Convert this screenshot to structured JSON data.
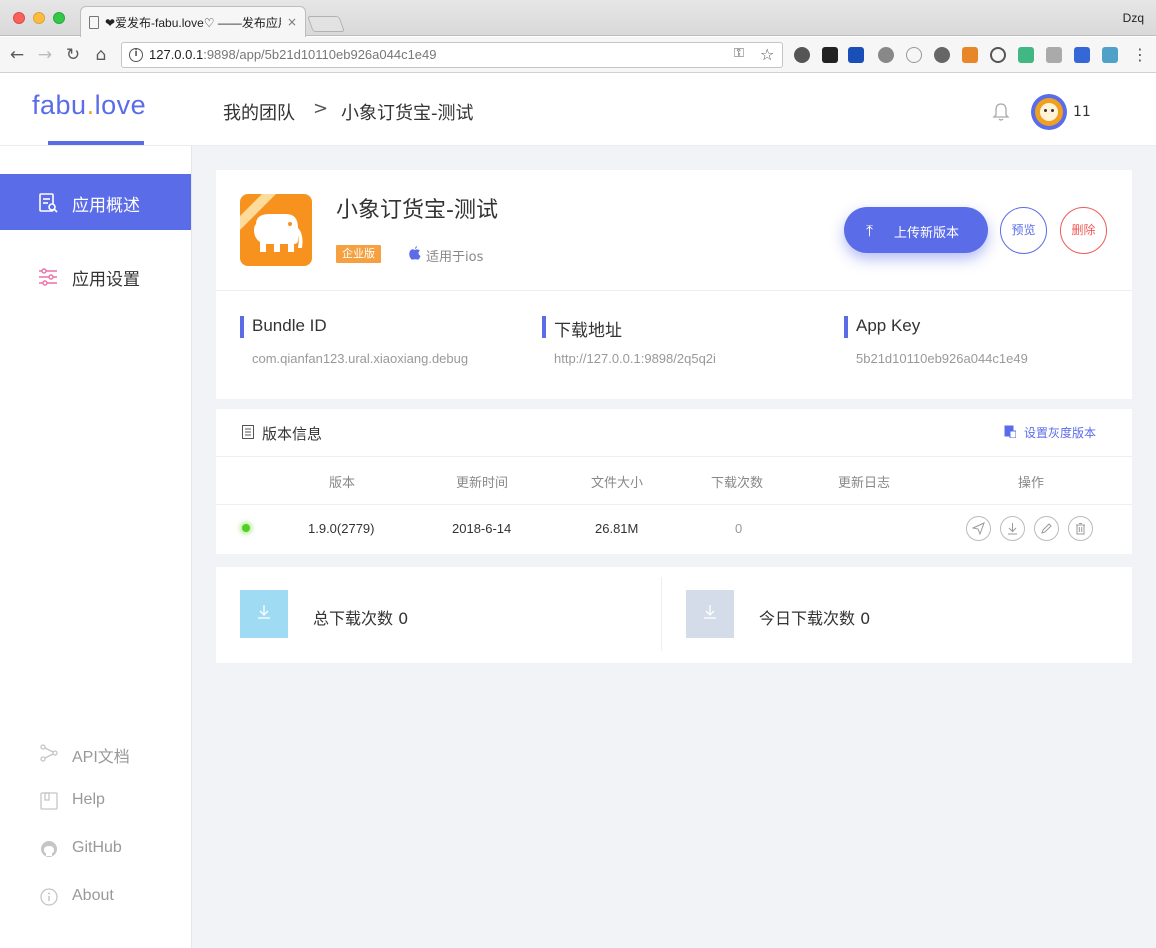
{
  "browser": {
    "tab_title": "❤爱发布-fabu.love♡ ——发布应用",
    "tab_close": "×",
    "profile": "Dzq",
    "url_host": "127.0.0.1",
    "url_rest": ":9898/app/5b21d10110eb926a044c1e49"
  },
  "header": {
    "logo_main": "fabu",
    "logo_dot": ".",
    "logo_end": "love",
    "breadcrumb": [
      "我的团队",
      "小象订货宝-测试"
    ],
    "breadcrumb_sep": ">",
    "user_name": "11"
  },
  "sidebar": {
    "items": [
      {
        "label": "应用概述",
        "icon": "app-overview-icon",
        "active": true
      },
      {
        "label": "应用设置",
        "icon": "settings-sliders-icon",
        "active": false
      }
    ],
    "links": [
      {
        "label": "API文档",
        "icon": "share-nodes-icon"
      },
      {
        "label": "Help",
        "icon": "book-icon"
      },
      {
        "label": "GitHub",
        "icon": "github-icon"
      },
      {
        "label": "About",
        "icon": "info-icon"
      }
    ]
  },
  "app": {
    "name": "小象订货宝-测试",
    "badge": "企业版",
    "platform": "适用于ios",
    "upload_label": "上传新版本",
    "preview_label": "预览",
    "delete_label": "删除",
    "meta": [
      {
        "title": "Bundle ID",
        "value": "com.qianfan123.ural.xiaoxiang.debug"
      },
      {
        "title": "下载地址",
        "value": "http://127.0.0.1:9898/2q5q2i"
      },
      {
        "title": "App Key",
        "value": "5b21d10110eb926a044c1e49"
      }
    ]
  },
  "versions": {
    "title": "版本信息",
    "gray_link": "设置灰度版本",
    "columns": [
      "版本",
      "更新时间",
      "文件大小",
      "下载次数",
      "更新日志",
      "操作"
    ],
    "rows": [
      {
        "version": "1.9.0(2779)",
        "date": "2018-6-14",
        "size": "26.81M",
        "downloads": "0",
        "log": ""
      }
    ]
  },
  "stats": {
    "total_label": "总下载次数 0",
    "today_label": "今日下载次数 0"
  },
  "colors": {
    "accent": "#5b6ce8",
    "danger": "#f05a5a",
    "badge": "#f5a142",
    "total_box": "#9fdcf3",
    "today_box": "#d3dce8"
  }
}
